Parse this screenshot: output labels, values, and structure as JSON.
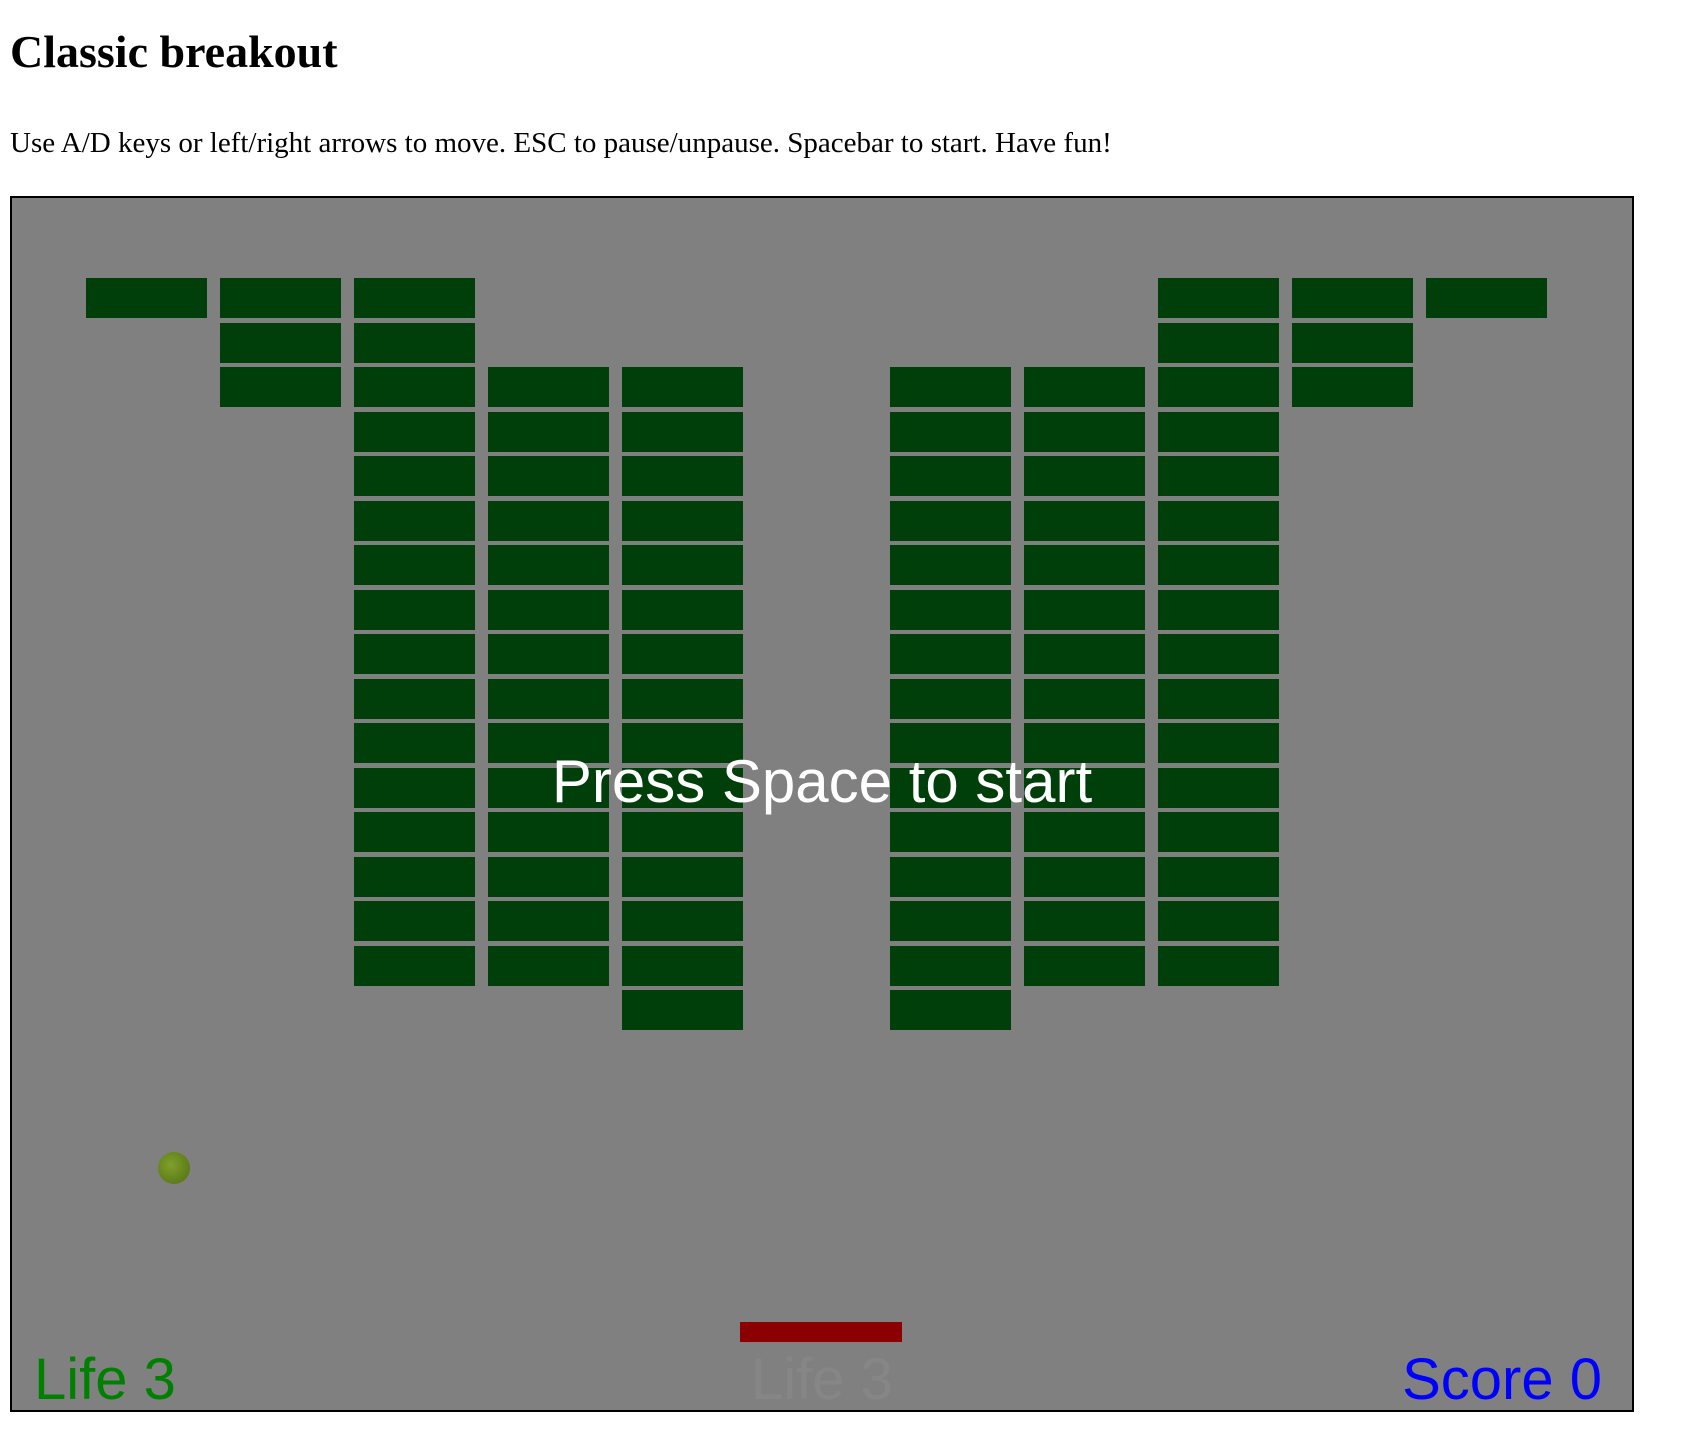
{
  "page": {
    "title": "Classic breakout",
    "instructions": "Use A/D keys or left/right arrows to move. ESC to pause/unpause. Spacebar to start. Have fun!"
  },
  "game": {
    "overlay_message": "Press Space to start",
    "life": "Life 3",
    "score": "Score 0",
    "ghost_status": "Life 3",
    "colors": {
      "background": "#808080",
      "brick": "#003f0a",
      "paddle": "#8b0000",
      "ball": "#6b8a1e",
      "life_text": "#008000",
      "score_text": "#0000ff",
      "overlay_text": "#ffffff",
      "ghost_text": "#868686"
    },
    "brick_grid": {
      "columns": 11,
      "rows": 17,
      "bricks_by_column": [
        [
          0
        ],
        [
          0,
          1,
          2
        ],
        [
          0,
          1,
          2,
          3,
          4,
          5,
          6,
          7,
          8,
          9,
          10,
          11,
          12,
          13,
          14,
          15
        ],
        [
          2,
          3,
          4,
          5,
          6,
          7,
          8,
          9,
          10,
          11,
          12,
          13,
          14,
          15
        ],
        [
          2,
          3,
          4,
          5,
          6,
          7,
          8,
          9,
          10,
          11,
          12,
          13,
          14,
          15,
          16
        ],
        [],
        [
          2,
          3,
          4,
          5,
          6,
          7,
          8,
          9,
          10,
          11,
          12,
          13,
          14,
          15,
          16
        ],
        [
          2,
          3,
          4,
          5,
          6,
          7,
          8,
          9,
          10,
          11,
          12,
          13,
          14,
          15
        ],
        [
          0,
          1,
          2,
          3,
          4,
          5,
          6,
          7,
          8,
          9,
          10,
          11,
          12,
          13,
          14,
          15
        ],
        [
          0,
          1,
          2
        ],
        [
          0
        ]
      ]
    }
  }
}
